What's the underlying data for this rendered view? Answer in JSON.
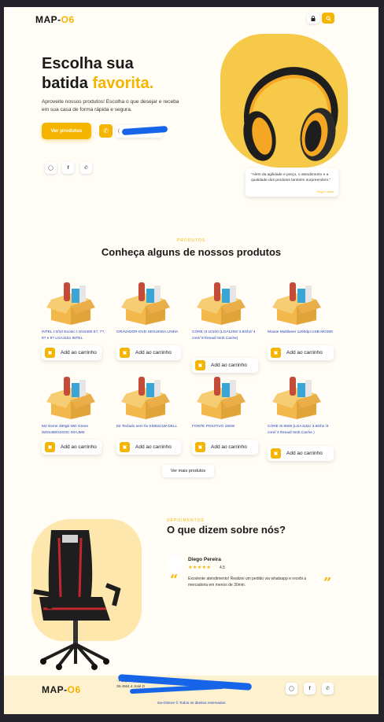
{
  "header": {
    "logo_main": "MAP-",
    "logo_accent": "O6",
    "lock_icon": "lock-icon",
    "search_icon": "search-icon"
  },
  "hero": {
    "title_line1": "Escolha sua",
    "title_line2a": "batida ",
    "title_line2b": "favorita.",
    "text": "Aproveite nossos produtos! Escolha o que desejar e receba em sua casa de forma rápida e segura.",
    "cta_label": "Ver produtos",
    "phone_text": "(",
    "quote": "\"Além da agilidade e preço, o atendimento e a qualidade dos produtos também surpreendem.\"",
    "quote_author": "Hugo Lopes",
    "socials": [
      "instagram-icon",
      "facebook-icon",
      "whatsapp-icon"
    ]
  },
  "products": {
    "kicker": "PRODUTOS",
    "title": "Conheça alguns de nossos produtos",
    "add_label": "Add ao carrinho",
    "items": [
      {
        "name": "INTEL I-3/10 Exonic    I-3/10400 6?, 7?, 8? e 9?    LGA1151    INTEL"
      },
      {
        "name": "GRAVADOR DVD SEGUNDA LINHA"
      },
      {
        "name": "CORE I3    10100 (LGA1200/ 3.6Ghz/ 4 core/ 8 thread/ 6mb Cache)"
      },
      {
        "name": "Mouse Multilaser 1200dpi USB MO300"
      },
      {
        "name": "M2 Nvme 480gb WD Green WDS480G2G0C    00AJM0"
      },
      {
        "name": "Kit Teclado sem fio KM5221W DELL"
      },
      {
        "name": "FONTE POSITIVO 150W"
      },
      {
        "name": "CORE I5    6500 (LGA1151/ 3.6Ghz /4 core/ 4 thread/ 6mb Cache )"
      }
    ],
    "more_label": "Ver mais produtos"
  },
  "testimonials": {
    "kicker": "DEPOIMENTOS",
    "title": "O que dizem sobre nós?",
    "reviewer": "Diego Pereira",
    "stars": "★★★★★",
    "rating": "4.5",
    "review": "Excelente atendimento! Realizei um pedido via whatsapp e recebi a mercadoria em menos de 30min."
  },
  "footer": {
    "logo_main": "MAP-",
    "logo_accent": "O6",
    "address_line1": "                  -                Parque Da",
    "address_line2": "39.4564.4                José D",
    "copyright": "ma-OStore © Todos os direitos reservados"
  },
  "colors": {
    "accent": "#f5b400",
    "page_bg": "#fffdf6",
    "link_blue": "#1f3fbf",
    "footer_bg": "#fdf1d0"
  }
}
